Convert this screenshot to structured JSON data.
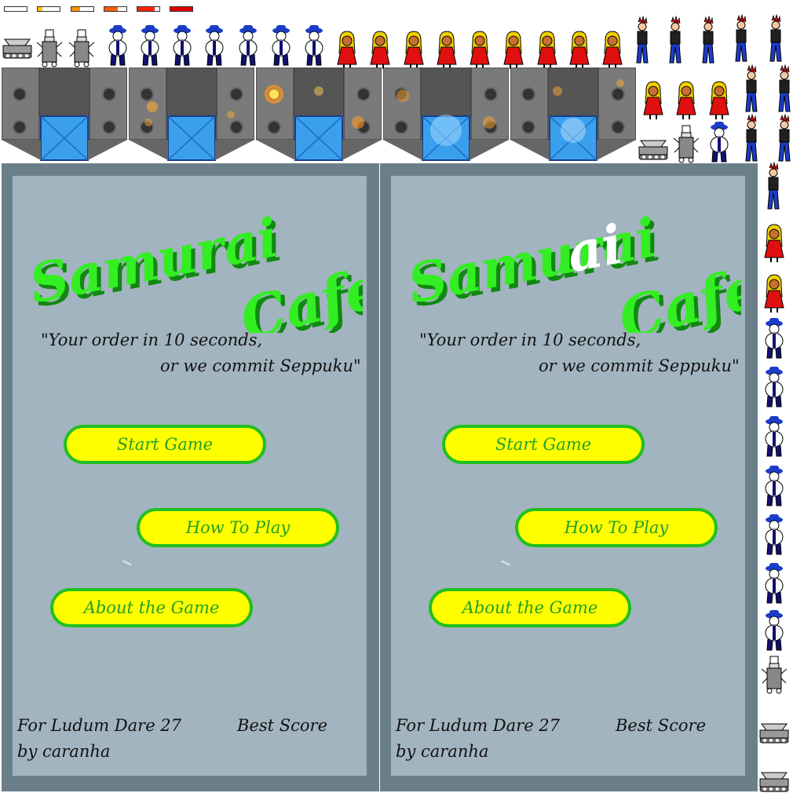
{
  "health_bars": [
    {
      "level": 0.0,
      "color": "#ffffff"
    },
    {
      "level": 0.2,
      "color": "#ffc000"
    },
    {
      "level": 0.4,
      "color": "#ff9000"
    },
    {
      "level": 0.6,
      "color": "#ff6000"
    },
    {
      "level": 0.8,
      "color": "#ff2000"
    },
    {
      "level": 1.0,
      "color": "#e00000"
    }
  ],
  "colors": {
    "title_green": "#33ee22",
    "title_shadow": "#118811",
    "button_fill": "#ffff00",
    "button_border": "#20c020",
    "button_text": "#22a022",
    "screen_frame": "#6b7f8a",
    "screen_panel": "#a2b4bf",
    "kitchen_metal": "#8e8e8e",
    "kitchen_door": "#3aa0ee"
  },
  "screens": [
    {
      "title_line1": "Samurai",
      "title_line2": "Cafe",
      "highlight_letters": "",
      "tagline_line1": "\"Your order in 10 seconds,",
      "tagline_line2": "or we commit Seppuku\"",
      "start_label": "Start Game",
      "howto_label": "How To Play",
      "about_label": "About the Game",
      "credit_line1": "For Ludum Dare 27",
      "credit_line2": "by caranha",
      "best_score_label": "Best Score"
    },
    {
      "title_line1": "Samurai",
      "title_line2": "Cafe",
      "highlight_letters": "ai",
      "tagline_line1": "\"Your order in 10 seconds,",
      "tagline_line2": "or we commit Seppuku\"",
      "start_label": "Start Game",
      "howto_label": "How To Play",
      "about_label": "About the Game",
      "credit_line1": "For Ludum Dare 27",
      "credit_line2": "by caranha",
      "best_score_label": "Best Score"
    }
  ],
  "sprites": {
    "samurai_icon": "samurai-sprite-icon",
    "robot_icon": "robot-chef-sprite-icon",
    "mixer_icon": "mixer-machine-sprite-icon",
    "girl_icon": "blonde-girl-sprite-icon",
    "punk_icon": "punk-customer-sprite-icon"
  },
  "kitchen_states": [
    "idle",
    "sparks",
    "fire",
    "splash",
    "glow"
  ]
}
